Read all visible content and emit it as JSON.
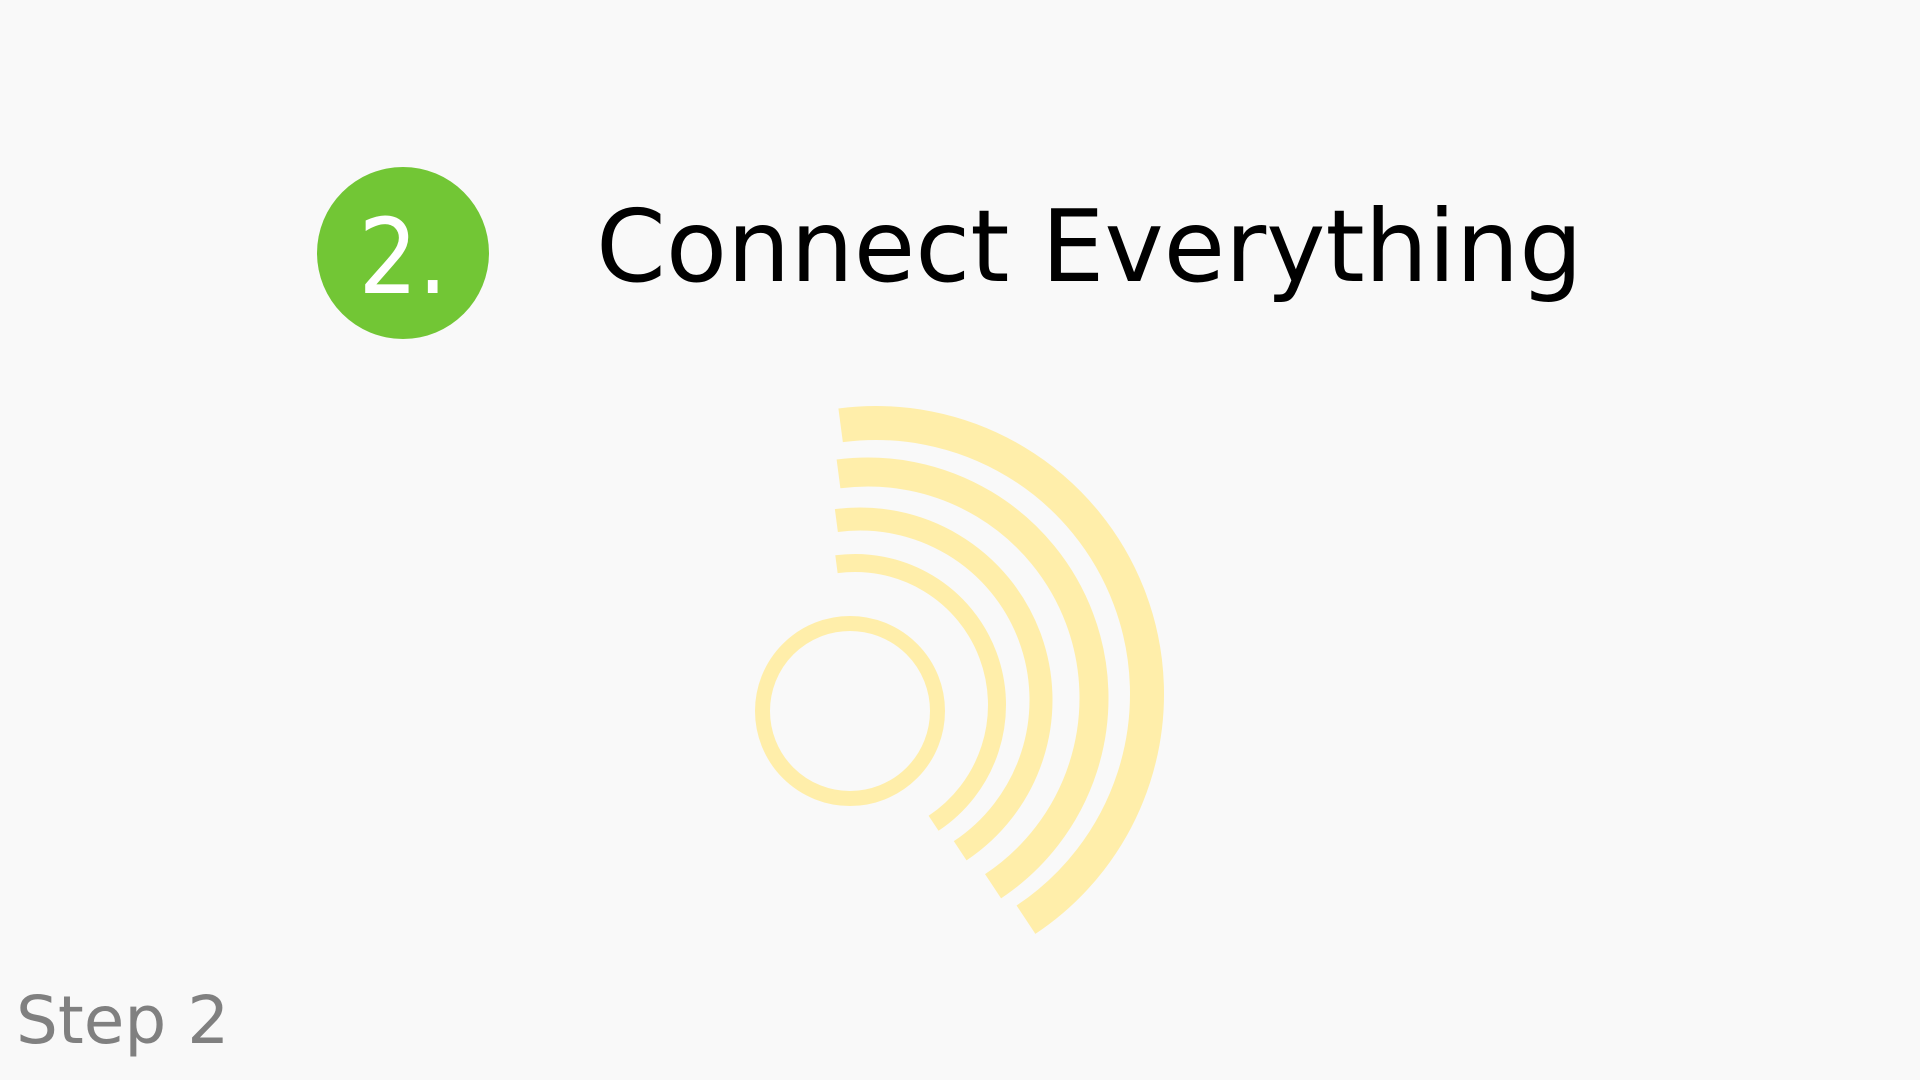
{
  "slide": {
    "step_number": "2.",
    "title": "Connect Everything",
    "footer_label": "Step 2"
  },
  "colors": {
    "background": "#f9f9f9",
    "badge": "#72c635",
    "rings": "#ffeeaa",
    "footer_text": "#808080"
  },
  "icons": [
    "signal-broadcast-icon"
  ]
}
